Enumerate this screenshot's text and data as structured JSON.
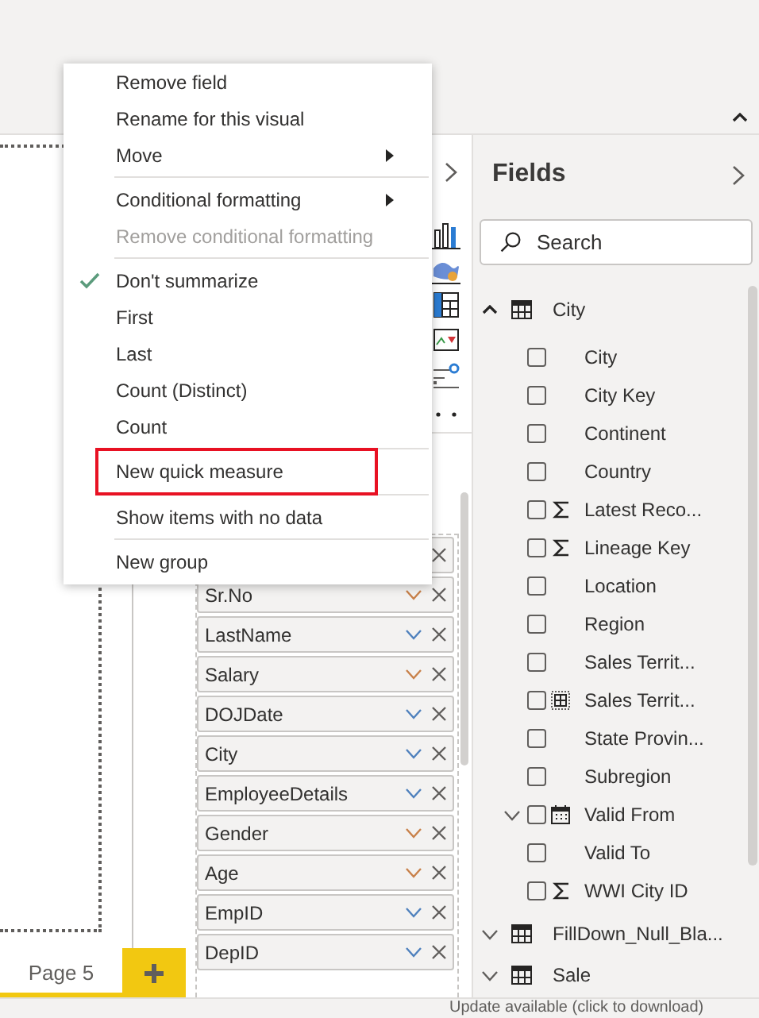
{
  "context_menu": {
    "groups": [
      [
        {
          "label": "Remove field",
          "disabled": false,
          "checked": false,
          "submenu": false,
          "highlighted": false
        },
        {
          "label": "Rename for this visual",
          "disabled": false,
          "checked": false,
          "submenu": false,
          "highlighted": false
        },
        {
          "label": "Move",
          "disabled": false,
          "checked": false,
          "submenu": true,
          "highlighted": false
        }
      ],
      [
        {
          "label": "Conditional formatting",
          "disabled": false,
          "checked": false,
          "submenu": true,
          "highlighted": false
        },
        {
          "label": "Remove conditional formatting",
          "disabled": true,
          "checked": false,
          "submenu": false,
          "highlighted": false
        }
      ],
      [
        {
          "label": "Don't summarize",
          "disabled": false,
          "checked": true,
          "submenu": false,
          "highlighted": false
        },
        {
          "label": "First",
          "disabled": false,
          "checked": false,
          "submenu": false,
          "highlighted": false
        },
        {
          "label": "Last",
          "disabled": false,
          "checked": false,
          "submenu": false,
          "highlighted": false
        },
        {
          "label": "Count (Distinct)",
          "disabled": false,
          "checked": false,
          "submenu": false,
          "highlighted": false
        },
        {
          "label": "Count",
          "disabled": false,
          "checked": false,
          "submenu": false,
          "highlighted": false
        }
      ],
      [
        {
          "label": "New quick measure",
          "disabled": false,
          "checked": false,
          "submenu": false,
          "highlighted": true
        }
      ],
      [
        {
          "label": "Show items with no data",
          "disabled": false,
          "checked": false,
          "submenu": false,
          "highlighted": false
        }
      ],
      [
        {
          "label": "New group",
          "disabled": false,
          "checked": false,
          "submenu": false,
          "highlighted": false
        }
      ]
    ]
  },
  "visualizations_pane": {
    "well_items": [
      {
        "kind": "covered"
      },
      {
        "kind": "field",
        "label": "Sr.No",
        "color": "#c8814a"
      },
      {
        "kind": "field",
        "label": "LastName",
        "color": "#4f81bd"
      },
      {
        "kind": "field",
        "label": "Salary",
        "color": "#c8814a"
      },
      {
        "kind": "field",
        "label": "DOJDate",
        "color": "#4f81bd"
      },
      {
        "kind": "field",
        "label": "City",
        "color": "#4f81bd"
      },
      {
        "kind": "field",
        "label": "EmployeeDetails",
        "color": "#4f81bd"
      },
      {
        "kind": "field",
        "label": "Gender",
        "color": "#c8814a"
      },
      {
        "kind": "field",
        "label": "Age",
        "color": "#c8814a"
      },
      {
        "kind": "field",
        "label": "EmpID",
        "color": "#4f81bd"
      },
      {
        "kind": "field",
        "label": "DepID",
        "color": "#4f81bd"
      }
    ]
  },
  "fields_pane": {
    "title": "Fields",
    "search": {
      "placeholder": "Search"
    },
    "tables": [
      {
        "name": "City",
        "expanded": true,
        "fields": [
          {
            "name": "City",
            "kind": "plain",
            "checked": false
          },
          {
            "name": "City Key",
            "kind": "plain",
            "checked": false
          },
          {
            "name": "Continent",
            "kind": "plain",
            "checked": false
          },
          {
            "name": "Country",
            "kind": "plain",
            "checked": false
          },
          {
            "name": "Latest Reco...",
            "kind": "sigma",
            "checked": false
          },
          {
            "name": "Lineage Key",
            "kind": "sigma",
            "checked": false
          },
          {
            "name": "Location",
            "kind": "plain",
            "checked": false
          },
          {
            "name": "Region",
            "kind": "plain",
            "checked": false
          },
          {
            "name": "Sales Territ...",
            "kind": "plain",
            "checked": false
          },
          {
            "name": "Sales Territ...",
            "kind": "geo",
            "checked": false
          },
          {
            "name": "State Provin...",
            "kind": "plain",
            "checked": false
          },
          {
            "name": "Subregion",
            "kind": "plain",
            "checked": false
          },
          {
            "name": "Valid From",
            "kind": "calendar",
            "checked": false,
            "expanded": false
          },
          {
            "name": "Valid To",
            "kind": "plain",
            "checked": false
          },
          {
            "name": "WWI City ID",
            "kind": "sigma",
            "checked": false
          }
        ]
      },
      {
        "name": "FillDown_Null_Bla...",
        "expanded": false
      },
      {
        "name": "Sale",
        "expanded": false
      }
    ]
  },
  "page_tabs": [
    {
      "label": "Page 5",
      "selected": true
    }
  ],
  "status_bar": {
    "text": "Update available (click to download)"
  }
}
